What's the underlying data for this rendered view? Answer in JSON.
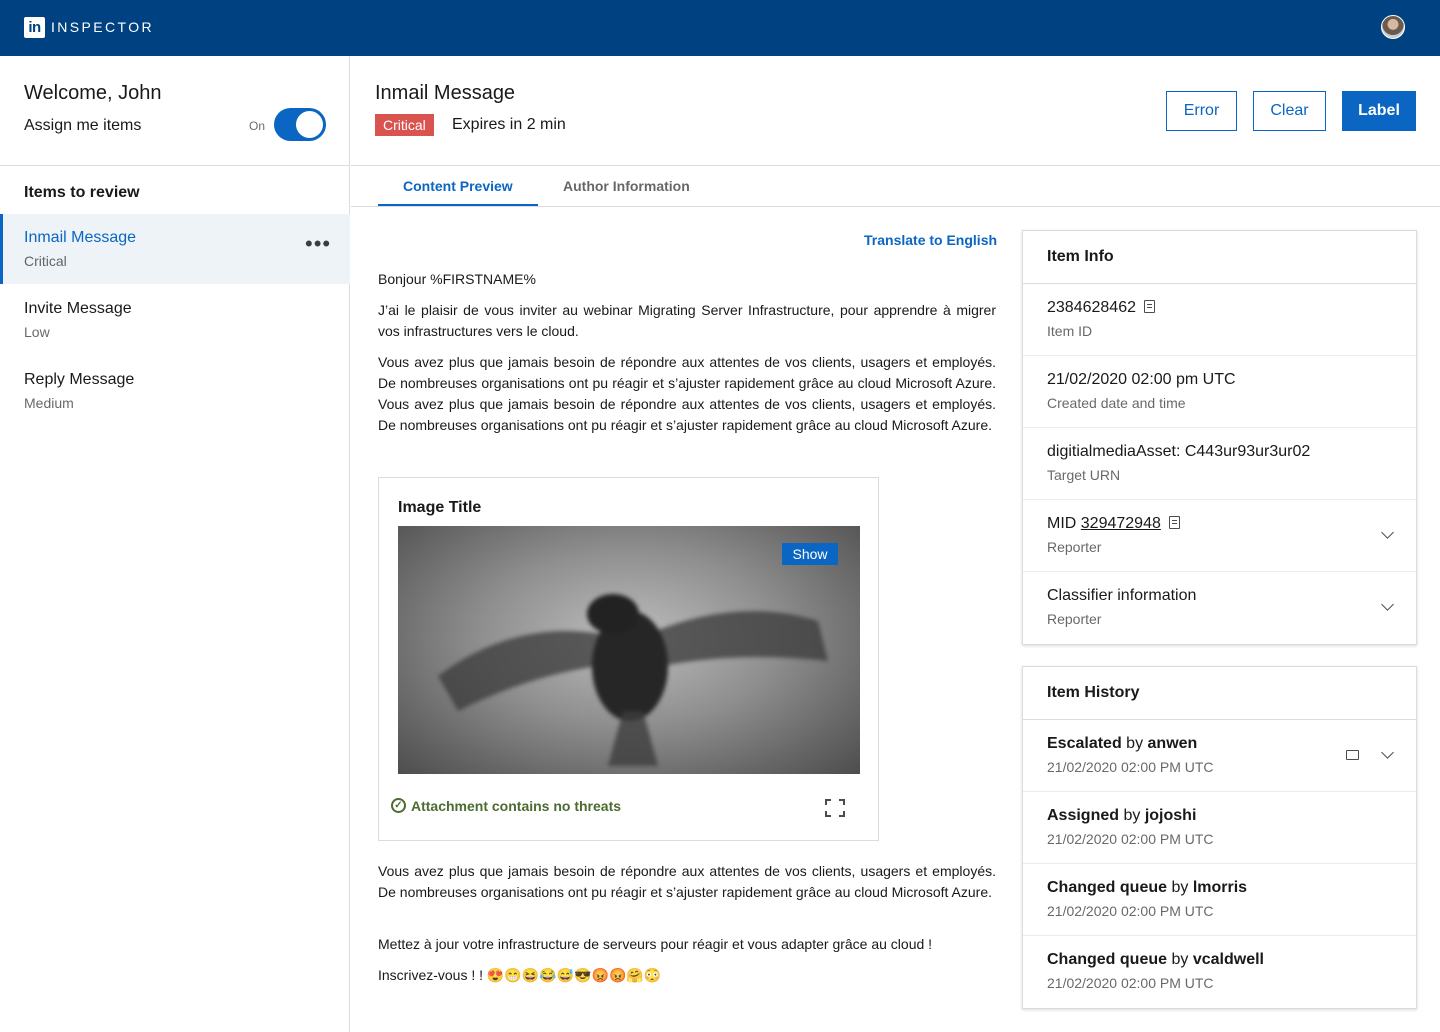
{
  "app": {
    "logo_text": "in",
    "brand": "INSPECTOR"
  },
  "sidebar": {
    "welcome": "Welcome, John",
    "assign_label": "Assign me items",
    "toggle_label": "On",
    "toggle_on": true,
    "section_title": "Items to review",
    "items": [
      {
        "title": "Inmail Message",
        "priority": "Critical"
      },
      {
        "title": "Invite Message",
        "priority": "Low"
      },
      {
        "title": "Reply Message",
        "priority": "Medium"
      }
    ]
  },
  "header": {
    "title": "Inmail Message",
    "badge": "Critical",
    "expires": "Expires in 2 min",
    "buttons": {
      "error": "Error",
      "clear": "Clear",
      "label": "Label"
    }
  },
  "tabs": [
    "Content Preview",
    "Author Information"
  ],
  "content": {
    "translate": "Translate to English",
    "greeting": "Bonjour %FIRSTNAME%",
    "para1": "J’ai le plaisir de vous inviter au webinar Migrating Server Infrastructure, pour apprendre à migrer vos infrastructures vers le cloud.",
    "para2": "Vous avez plus que jamais besoin de répondre aux attentes de vos clients, usagers et employés. De nombreuses organisations ont pu réagir et s’ajuster rapidement grâce au cloud Microsoft Azure. Vous avez plus que jamais besoin de répondre aux attentes de vos clients, usagers et employés. De nombreuses organisations ont pu réagir et s’ajuster rapidement grâce au cloud Microsoft Azure.",
    "image_title": "Image Title",
    "show": "Show",
    "attachment_status": "Attachment contains no threats",
    "para3": "Vous avez plus que jamais besoin de répondre aux attentes de vos clients, usagers et employés. De nombreuses organisations ont pu réagir et s’ajuster rapidement grâce au cloud Microsoft Azure.",
    "para4": "Mettez à jour votre infrastructure de serveurs pour réagir et vous adapter grâce au cloud !",
    "para5": "Inscrivez-vous ! ! 😍😁😆😂😅😎😡😡🤗😳"
  },
  "item_info": {
    "title": "Item Info",
    "rows": [
      {
        "value": "2384628462",
        "label": "Item ID"
      },
      {
        "value": "21/02/2020 02:00 pm UTC",
        "label": "Created date and time"
      },
      {
        "value": "digitialmediaAsset: C443ur93ur3ur02",
        "label": "Target URN"
      },
      {
        "prefix": "MID",
        "value": "329472948",
        "label": "Reporter"
      },
      {
        "value": "Classifier information",
        "label": "Reporter"
      }
    ]
  },
  "item_history": {
    "title": "Item History",
    "connector": "by",
    "rows": [
      {
        "action": "Escalated",
        "user": "anwen",
        "time": "21/02/2020 02:00 PM UTC"
      },
      {
        "action": "Assigned",
        "user": "jojoshi",
        "time": "21/02/2020 02:00 PM UTC"
      },
      {
        "action": "Changed queue",
        "user": "lmorris",
        "time": "21/02/2020 02:00 PM UTC"
      },
      {
        "action": "Changed queue",
        "user": "vcaldwell",
        "time": "21/02/2020 02:00 PM UTC"
      }
    ]
  },
  "colors": {
    "brand_bar": "#004182",
    "accent": "#0a66c2",
    "critical": "#d9534f",
    "safe": "#4b6b2f"
  },
  "icons": [
    "linkedin-logo-icon",
    "copy-icon",
    "chevron-down-icon",
    "comment-icon",
    "check-circle-icon",
    "expand-icon",
    "more-icon"
  ]
}
